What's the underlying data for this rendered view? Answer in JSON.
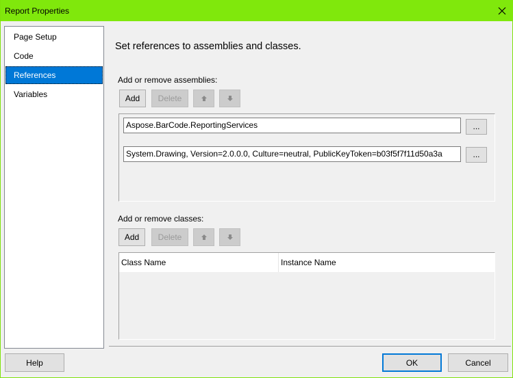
{
  "window": {
    "title": "Report Properties",
    "close_icon": "close-icon",
    "accent_color": "#80e80c"
  },
  "nav": {
    "items": [
      {
        "label": "Page Setup",
        "selected": false
      },
      {
        "label": "Code",
        "selected": false
      },
      {
        "label": "References",
        "selected": true
      },
      {
        "label": "Variables",
        "selected": false
      }
    ],
    "selected_color": "#0078d7"
  },
  "main": {
    "heading": "Set references to assemblies and classes.",
    "assemblies": {
      "label": "Add or remove assemblies:",
      "add_label": "Add",
      "delete_label": "Delete",
      "move_up_icon": "arrow-up-icon",
      "move_down_icon": "arrow-down-icon",
      "items": [
        {
          "value": "Aspose.BarCode.ReportingServices",
          "browse_label": "..."
        },
        {
          "value": "System.Drawing, Version=2.0.0.0, Culture=neutral, PublicKeyToken=b03f5f7f11d50a3a",
          "browse_label": "..."
        }
      ]
    },
    "classes": {
      "label": "Add or remove classes:",
      "add_label": "Add",
      "delete_label": "Delete",
      "move_up_icon": "arrow-up-icon",
      "move_down_icon": "arrow-down-icon",
      "columns": [
        "Class Name",
        "Instance Name"
      ],
      "rows": []
    }
  },
  "footer": {
    "help_label": "Help",
    "ok_label": "OK",
    "cancel_label": "Cancel"
  }
}
